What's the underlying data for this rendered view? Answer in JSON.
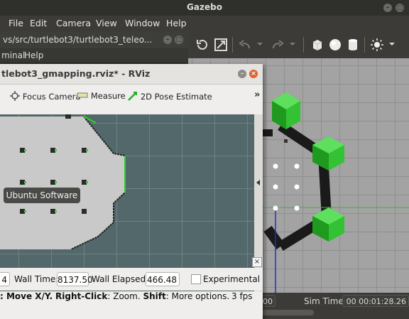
{
  "gazebo": {
    "title": "Gazebo",
    "menu": [
      "File",
      "Edit",
      "Camera",
      "View",
      "Window",
      "Help"
    ],
    "sim_time_label": "Sim Time:",
    "sim_time_value": "00 00:01:28.26",
    "real_time_partial": "00"
  },
  "terminal": {
    "title": "vs/src/turtlebot3/turtlebot3_teleo...",
    "menu": [
      "minal",
      "Help"
    ]
  },
  "rviz": {
    "title": "tlebot3_gmapping.rviz* - RViz",
    "toolbar": {
      "focus_camera": "Focus Camera",
      "measure": "Measure",
      "pose_estimate": "2D Pose Estimate",
      "more": "»"
    },
    "time": {
      "ros_time_partial": "4",
      "wall_time_label": "Wall Time:",
      "wall_time_value": "8137.50",
      "wall_elapsed_label": "Wall Elapsed:",
      "wall_elapsed_value": "466.48",
      "experimental_label": "Experimental"
    },
    "status": {
      "hint_prefix": ": Move X/Y.",
      "right_click": "Right-Click",
      "zoom": ": Zoom.",
      "shift": "Shift",
      "more_options": ": More options.",
      "fps": "3 fps"
    }
  },
  "tooltip": {
    "text": "Ubuntu Software"
  },
  "colors": {
    "map_background": "#53686a",
    "map_free_space": "#c9c9c9",
    "gazebo_green": "#2fb52f",
    "ubuntu_panel": "#3c3b37"
  }
}
